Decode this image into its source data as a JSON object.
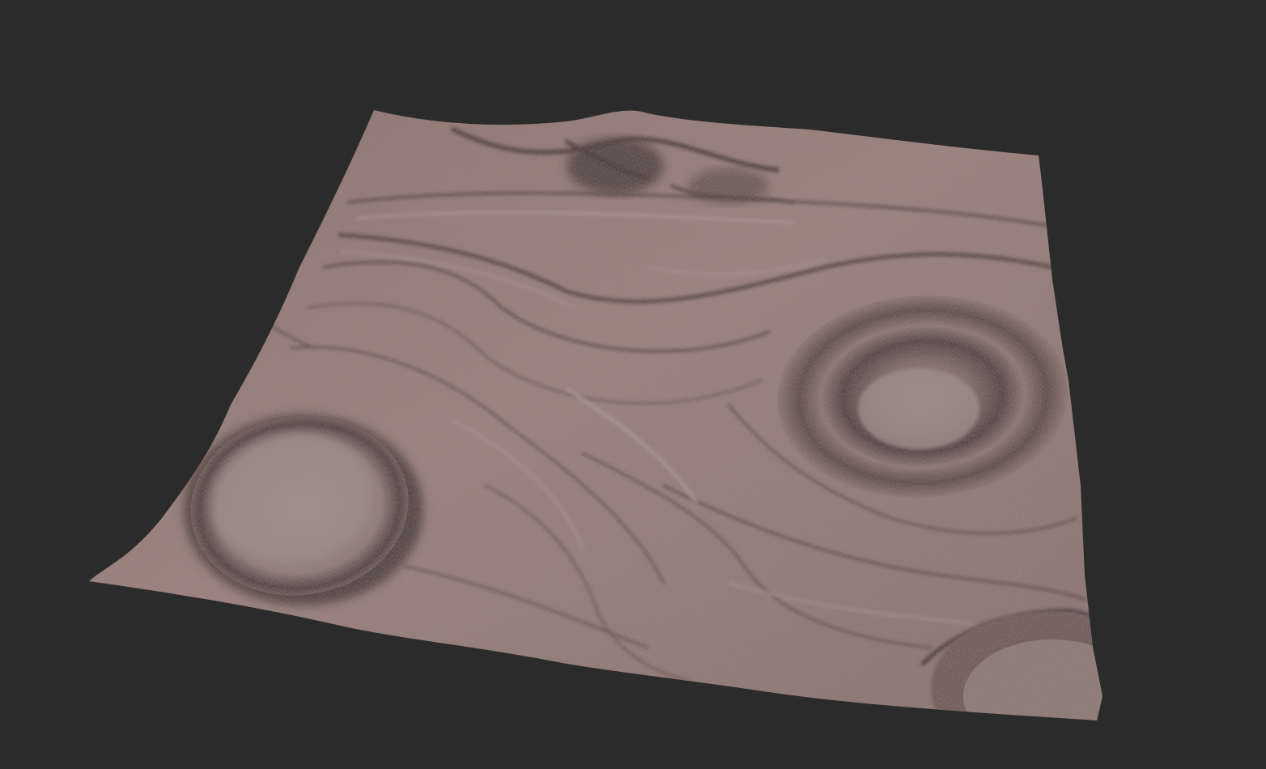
{
  "viewport": {
    "background": "#2b2b2b",
    "subject": "terrain-mesh",
    "features": [
      "crater-left",
      "crater-right",
      "crater-bottom-right",
      "ridge-top"
    ]
  },
  "terrain": {
    "base_color": "#8f7570",
    "dark_color": "#4a3c3a",
    "light_color": "#b8a6a4",
    "accent_color": "#b07a72"
  }
}
